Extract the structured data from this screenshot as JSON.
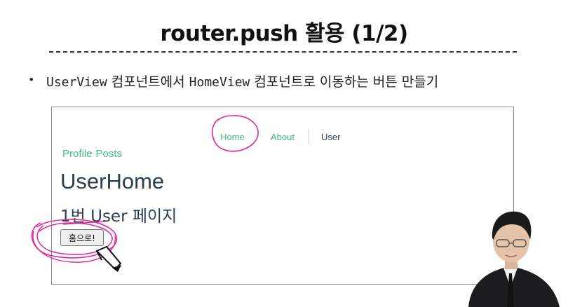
{
  "slide": {
    "title": "router.push 활용 (1/2)",
    "bullet": {
      "part1": "UserView",
      "part2": " 컴포넌트에서 ",
      "part3": "HomeView",
      "part4": " 컴포넌트로 이동하는 버튼 만들기"
    }
  },
  "app": {
    "nav": {
      "home": "Home",
      "about": "About",
      "user": "User"
    },
    "subnav": {
      "profile": "Profile",
      "posts": "Posts"
    },
    "heading": "UserHome",
    "subheading": "1번 User 페이지",
    "button_label": "홈으로!"
  },
  "colors": {
    "link": "#42b983",
    "annotation": "#e0289a",
    "text": "#2c3e50"
  }
}
